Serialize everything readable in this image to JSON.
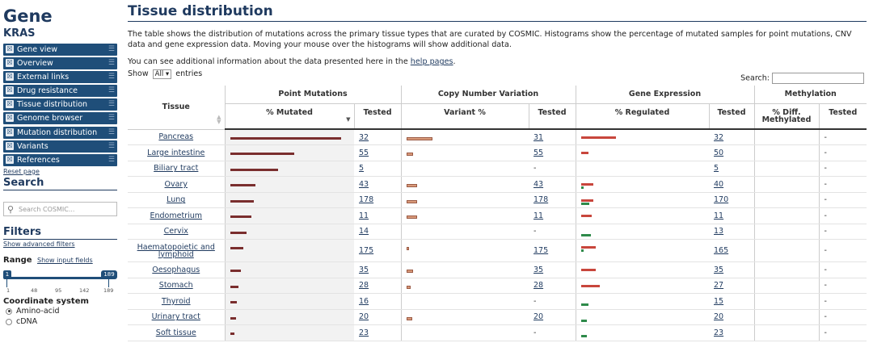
{
  "sidebar": {
    "title": "Gene",
    "gene": "KRAS",
    "nav": [
      {
        "label": "Gene view"
      },
      {
        "label": "Overview"
      },
      {
        "label": "External links"
      },
      {
        "label": "Drug resistance"
      },
      {
        "label": "Tissue distribution"
      },
      {
        "label": "Genome browser"
      },
      {
        "label": "Mutation distribution"
      },
      {
        "label": "Variants"
      },
      {
        "label": "References"
      }
    ],
    "reset": "Reset page",
    "search_heading": "Search",
    "search_placeholder": "Search COSMIC...",
    "filters_heading": "Filters",
    "advanced_filters": "Show advanced filters",
    "range_label": "Range",
    "show_input_fields": "Show input fields",
    "range_min": "1",
    "range_max": "189",
    "ticks": [
      "1",
      "48",
      "95",
      "142",
      "189"
    ],
    "coord_heading": "Coordinate system",
    "coord_options": [
      "Amino-acid",
      "cDNA"
    ],
    "coord_selected": "Amino-acid"
  },
  "main": {
    "title": "Tissue distribution",
    "description": "The table shows the distribution of mutations across the primary tissue types that are curated by COSMIC. Histograms show the percentage of mutated samples for point mutations, CNV data and gene expression data. Moving your mouse over the histograms will show additional data.",
    "info_prefix": "You can see additional information about the data presented here in the ",
    "info_link": "help pages",
    "info_suffix": ".",
    "show_label": "Show",
    "show_value": "All ▾",
    "entries_label": "entries",
    "search_label": "Search:"
  },
  "table": {
    "group_headers": {
      "tissue": "Tissue",
      "pm": "Point Mutations",
      "cnv": "Copy Number Variation",
      "ge": "Gene Expression",
      "meth": "Methylation"
    },
    "sub_headers": {
      "pm_mut": "% Mutated",
      "pm_tested": "Tested",
      "cnv_var": "Variant %",
      "cnv_tested": "Tested",
      "ge_reg": "% Regulated",
      "ge_tested": "Tested",
      "meth_diff": "% Diff. Methylated",
      "meth_tested": "Tested"
    },
    "rows": [
      {
        "tissue": "Pancreas",
        "pm_pct": 0.93,
        "pm_tested": "32",
        "cnv_pct": 0.22,
        "cnv_tested": "31",
        "ge_up": 0.28,
        "ge_dn": 0,
        "ge_tested": "32",
        "meth_tested": "-"
      },
      {
        "tissue": "Large intestine",
        "pm_pct": 0.54,
        "pm_tested": "55",
        "cnv_pct": 0.06,
        "cnv_tested": "55",
        "ge_up": 0.06,
        "ge_dn": 0,
        "ge_tested": "50",
        "meth_tested": "-"
      },
      {
        "tissue": "Biliary tract",
        "pm_pct": 0.4,
        "pm_tested": "5",
        "cnv_pct": 0,
        "cnv_tested": "-",
        "ge_up": 0,
        "ge_dn": 0,
        "ge_tested": "5",
        "meth_tested": "-"
      },
      {
        "tissue": "Ovary",
        "pm_pct": 0.21,
        "pm_tested": "43",
        "cnv_pct": 0.09,
        "cnv_tested": "43",
        "ge_up": 0.1,
        "ge_dn": 0.02,
        "ge_tested": "40",
        "meth_tested": "-"
      },
      {
        "tissue": "Lung",
        "pm_pct": 0.2,
        "pm_tested": "178",
        "cnv_pct": 0.09,
        "cnv_tested": "178",
        "ge_up": 0.1,
        "ge_dn": 0.07,
        "ge_tested": "170",
        "meth_tested": "-"
      },
      {
        "tissue": "Endometrium",
        "pm_pct": 0.18,
        "pm_tested": "11",
        "cnv_pct": 0.09,
        "cnv_tested": "11",
        "ge_up": 0.09,
        "ge_dn": 0,
        "ge_tested": "11",
        "meth_tested": "-"
      },
      {
        "tissue": "Cervix",
        "pm_pct": 0.14,
        "pm_tested": "14",
        "cnv_pct": 0,
        "cnv_tested": "-",
        "ge_up": 0,
        "ge_dn": 0.08,
        "ge_tested": "13",
        "meth_tested": "-"
      },
      {
        "tissue": "Haematopoietic and lymphoid",
        "pm_pct": 0.11,
        "pm_tested": "175",
        "cnv_pct": 0.01,
        "cnv_tested": "175",
        "ge_up": 0.12,
        "ge_dn": 0.02,
        "ge_tested": "165",
        "meth_tested": "-"
      },
      {
        "tissue": "Oesophagus",
        "pm_pct": 0.09,
        "pm_tested": "35",
        "cnv_pct": 0.06,
        "cnv_tested": "35",
        "ge_up": 0.12,
        "ge_dn": 0,
        "ge_tested": "35",
        "meth_tested": "-"
      },
      {
        "tissue": "Stomach",
        "pm_pct": 0.07,
        "pm_tested": "28",
        "cnv_pct": 0.04,
        "cnv_tested": "28",
        "ge_up": 0.15,
        "ge_dn": 0,
        "ge_tested": "27",
        "meth_tested": "-"
      },
      {
        "tissue": "Thyroid",
        "pm_pct": 0.06,
        "pm_tested": "16",
        "cnv_pct": 0,
        "cnv_tested": "-",
        "ge_up": 0,
        "ge_dn": 0.06,
        "ge_tested": "15",
        "meth_tested": "-"
      },
      {
        "tissue": "Urinary tract",
        "pm_pct": 0.05,
        "pm_tested": "20",
        "cnv_pct": 0.05,
        "cnv_tested": "20",
        "ge_up": 0,
        "ge_dn": 0.05,
        "ge_tested": "20",
        "meth_tested": "-"
      },
      {
        "tissue": "Soft tissue",
        "pm_pct": 0.04,
        "pm_tested": "23",
        "cnv_pct": 0,
        "cnv_tested": "-",
        "ge_up": 0,
        "ge_dn": 0.05,
        "ge_tested": "23",
        "meth_tested": "-"
      }
    ]
  },
  "colors": {
    "brand": "#1f3a5f",
    "nav_bg": "#1f4e79",
    "point_mutation_bar": "#7a2e2e",
    "cnv_bar": "#d99a7a",
    "overexpression_bar": "#c8463c",
    "underexpression_bar": "#2e8a4a"
  }
}
